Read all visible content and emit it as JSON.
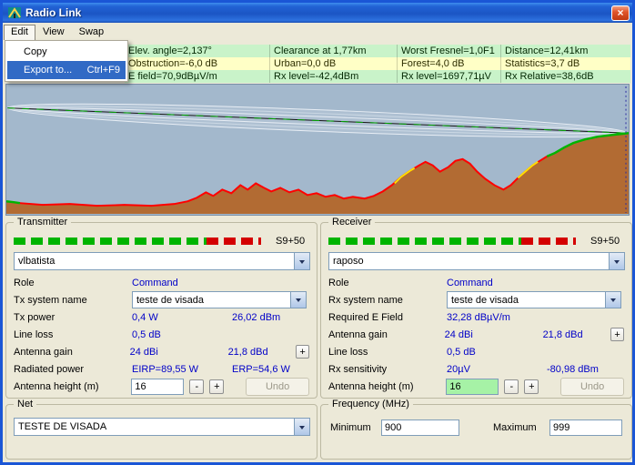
{
  "window": {
    "title": "Radio Link"
  },
  "icons": {
    "close": "×"
  },
  "menubar": {
    "items": [
      {
        "label": "Edit"
      },
      {
        "label": "View"
      },
      {
        "label": "Swap"
      }
    ]
  },
  "edit_menu": {
    "items": [
      {
        "label": "Copy",
        "shortcut": ""
      },
      {
        "label": "Export to...",
        "shortcut": "Ctrl+F9"
      }
    ]
  },
  "info": {
    "rows": [
      {
        "cells": [
          "Elev. angle=2,137°",
          "Clearance at 1,77km",
          "Worst Fresnel=1,0F1",
          "Distance=12,41km"
        ]
      },
      {
        "cells": [
          "Obstruction=-6,0 dB",
          "Urban=0,0 dB",
          "Forest=4,0 dB",
          "Statistics=3,7 dB"
        ]
      },
      {
        "cells": [
          "E field=70,9dBµV/m",
          "Rx level=-42,4dBm",
          "Rx level=1697,71µV",
          "Rx Relative=38,6dB"
        ]
      }
    ]
  },
  "transmitter": {
    "title": "Transmitter",
    "meter_label": "S9+50",
    "unit": "vlbatista",
    "role_label": "Role",
    "role_value": "Command",
    "system_label": "Tx system name",
    "system_value": "teste de visada",
    "power_label": "Tx power",
    "power_w": "0,4 W",
    "power_dbm": "26,02 dBm",
    "lineloss_label": "Line loss",
    "lineloss_value": "0,5 dB",
    "gain_label": "Antenna gain",
    "gain_dbi": "24 dBi",
    "gain_dbd": "21,8 dBd",
    "gain_plus": "+",
    "radiated_label": "Radiated power",
    "eirp": "EIRP=89,55 W",
    "erp": "ERP=54,6 W",
    "height_label": "Antenna height (m)",
    "height_value": "16",
    "minus": "-",
    "plus": "+",
    "undo": "Undo"
  },
  "receiver": {
    "title": "Receiver",
    "meter_label": "S9+50",
    "unit": "raposo",
    "role_label": "Role",
    "role_value": "Command",
    "system_label": "Rx system name",
    "system_value": "teste de visada",
    "efield_label": "Required E Field",
    "efield_value": "32,28 dBµV/m",
    "gain_label": "Antenna gain",
    "gain_dbi": "24 dBi",
    "gain_dbd": "21,8 dBd",
    "gain_plus": "+",
    "lineloss_label": "Line loss",
    "lineloss_value": "0,5 dB",
    "sens_label": "Rx sensitivity",
    "sens_uv": "20µV",
    "sens_dbm": "-80,98 dBm",
    "height_label": "Antenna height (m)",
    "height_value": "16",
    "minus": "-",
    "plus": "+",
    "undo": "Undo"
  },
  "net": {
    "title": "Net",
    "value": "TESTE DE VISADA"
  },
  "frequency": {
    "title": "Frequency (MHz)",
    "min_label": "Minimum",
    "min_value": "900",
    "max_label": "Maximum",
    "max_value": "999"
  },
  "colors": {
    "value_text": "#0000C8",
    "menu_highlight": "#316AC5",
    "info_green": "#C9F3C9",
    "info_yellow": "#FFFFC6",
    "meter_green": "#00B400",
    "meter_red": "#D40000",
    "terrain_brown": "#B26B33",
    "chart_sky": "#A3B8CC",
    "rx_height_highlight": "#A6F2A6",
    "clear_path_green": "#00B400",
    "obstructed_red": "#FF0000",
    "marginal_yellow": "#FFE000"
  }
}
